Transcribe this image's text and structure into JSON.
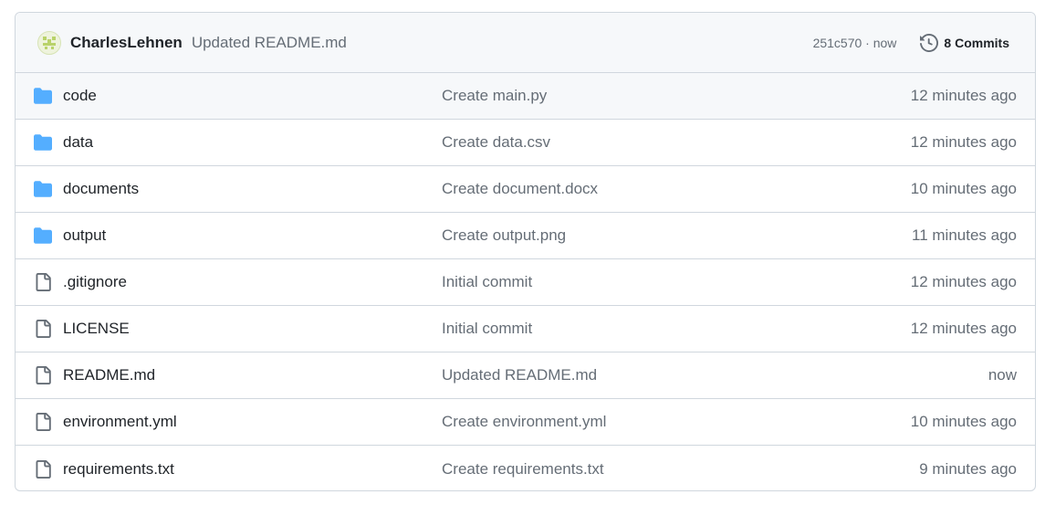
{
  "latest_commit": {
    "author": "CharlesLehnen",
    "message": "Updated README.md",
    "sha_time": "251c570 · now",
    "commits_label": "8 Commits",
    "avatar_icon": "identicon-avatar",
    "history_icon": "history-icon"
  },
  "files": [
    {
      "type": "folder",
      "name": "code",
      "message": "Create main.py",
      "time": "12 minutes ago"
    },
    {
      "type": "folder",
      "name": "data",
      "message": "Create data.csv",
      "time": "12 minutes ago"
    },
    {
      "type": "folder",
      "name": "documents",
      "message": "Create document.docx",
      "time": "10 minutes ago"
    },
    {
      "type": "folder",
      "name": "output",
      "message": "Create output.png",
      "time": "11 minutes ago"
    },
    {
      "type": "file",
      "name": ".gitignore",
      "message": "Initial commit",
      "time": "12 minutes ago"
    },
    {
      "type": "file",
      "name": "LICENSE",
      "message": "Initial commit",
      "time": "12 minutes ago"
    },
    {
      "type": "file",
      "name": "README.md",
      "message": "Updated README.md",
      "time": "now"
    },
    {
      "type": "file",
      "name": "environment.yml",
      "message": "Create environment.yml",
      "time": "10 minutes ago"
    },
    {
      "type": "file",
      "name": "requirements.txt",
      "message": "Create requirements.txt",
      "time": "9 minutes ago"
    }
  ],
  "colors": {
    "folder": "#54aeff",
    "file_icon": "#656d76",
    "border": "#d0d7de",
    "header_bg": "#f6f8fa"
  }
}
